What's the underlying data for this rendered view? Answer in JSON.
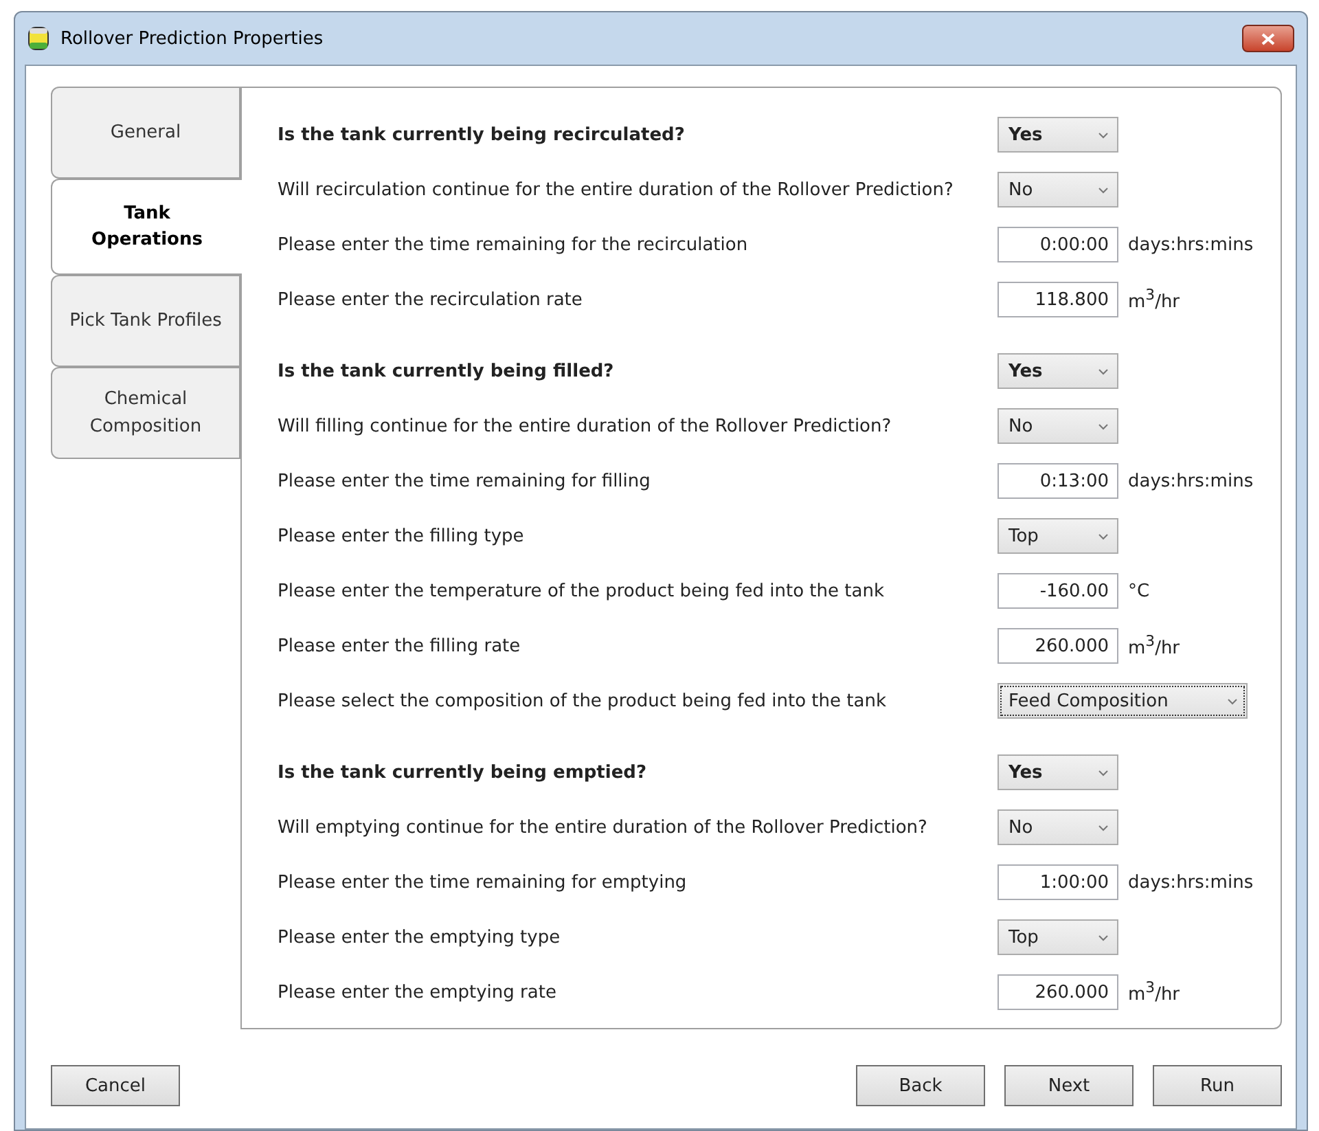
{
  "window": {
    "title": "Rollover Prediction Properties"
  },
  "tabs": [
    {
      "label": "General",
      "selected": false
    },
    {
      "label": "Tank Operations",
      "selected": true
    },
    {
      "label": "Pick Tank Profiles",
      "selected": false
    },
    {
      "label": "Chemical Composition",
      "selected": false
    }
  ],
  "groups": [
    {
      "rows": [
        {
          "kind": "question",
          "label": "Is the tank currently being recirculated?",
          "value": "Yes"
        },
        {
          "kind": "select",
          "label": "Will recirculation continue for the entire duration of the Rollover Prediction?",
          "value": "No"
        },
        {
          "kind": "input",
          "label": "Please enter the time remaining for the recirculation",
          "value": "0:00:00",
          "unit": "days:hrs:mins"
        },
        {
          "kind": "input",
          "label": "Please enter the recirculation rate",
          "value": "118.800",
          "unit": "m$^{3}$/hr"
        }
      ]
    },
    {
      "rows": [
        {
          "kind": "question",
          "label": "Is the tank currently being filled?",
          "value": "Yes"
        },
        {
          "kind": "select",
          "label": "Will filling continue for the entire duration of the Rollover Prediction?",
          "value": "No"
        },
        {
          "kind": "input",
          "label": "Please enter the time remaining for filling",
          "value": "0:13:00",
          "unit": "days:hrs:mins"
        },
        {
          "kind": "select",
          "label": "Please enter the filling type",
          "value": "Top"
        },
        {
          "kind": "input",
          "label": "Please enter the temperature of the product being fed into the tank",
          "value": "-160.00",
          "unit": "°C"
        },
        {
          "kind": "input",
          "label": "Please enter the filling rate",
          "value": "260.000",
          "unit": "m$^{3}$/hr"
        },
        {
          "kind": "wide-select",
          "label": "Please select the composition of the product being fed into the tank",
          "value": "Feed Composition",
          "focused": true
        }
      ]
    },
    {
      "rows": [
        {
          "kind": "question",
          "label": "Is the tank currently being emptied?",
          "value": "Yes"
        },
        {
          "kind": "select",
          "label": "Will emptying continue for the entire duration of the Rollover Prediction?",
          "value": "No"
        },
        {
          "kind": "input",
          "label": "Please enter the time remaining for emptying",
          "value": "1:00:00",
          "unit": "days:hrs:mins"
        },
        {
          "kind": "select",
          "label": "Please enter the emptying type",
          "value": "Top"
        },
        {
          "kind": "input",
          "label": "Please enter the emptying rate",
          "value": "260.000",
          "unit": "m$^{3}$/hr"
        }
      ]
    }
  ],
  "buttons": {
    "left": [
      "Cancel"
    ],
    "right": [
      "Back",
      "Next",
      "Run"
    ]
  }
}
